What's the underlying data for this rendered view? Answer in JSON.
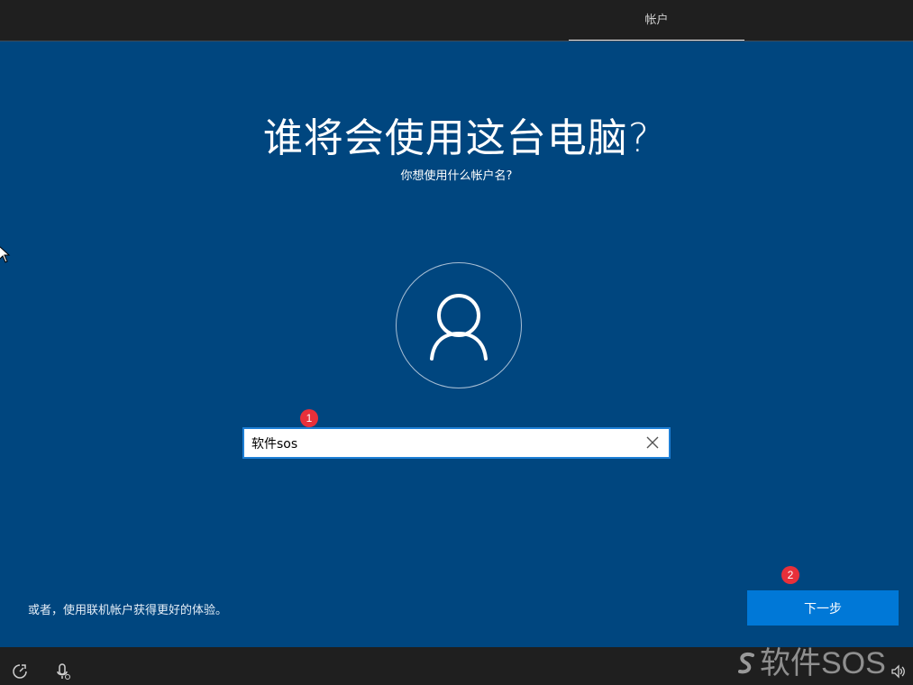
{
  "header": {
    "tab_label": "帐户"
  },
  "main": {
    "title": "谁将会使用这台电脑?",
    "subtitle": "你想使用什么帐户名?",
    "username_input": {
      "value": "软件sos",
      "placeholder": ""
    },
    "online_account_text": "或者，使用联机帐户获得更好的体验。",
    "next_button_label": "下一步"
  },
  "annotations": {
    "badge_1": "1",
    "badge_2": "2"
  },
  "watermark": "软件SOS",
  "icons": {
    "avatar": "user-icon",
    "clear": "close-icon",
    "ease_of_access": "ease-of-access-icon",
    "microphone": "microphone-icon",
    "volume": "volume-icon"
  },
  "colors": {
    "background": "#00467f",
    "topbar": "#1f1f1f",
    "accent": "#0078d7",
    "badge": "#e8303a"
  }
}
